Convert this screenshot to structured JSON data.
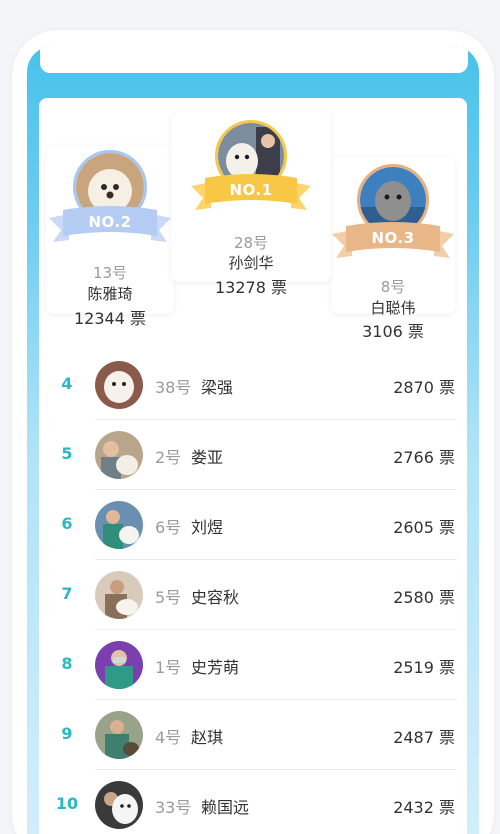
{
  "podium": [
    {
      "rank_label": "NO.1",
      "number": "28号",
      "name": "孙剑华",
      "votes": "13278 票"
    },
    {
      "rank_label": "NO.2",
      "number": "13号",
      "name": "陈雅琦",
      "votes": "12344 票"
    },
    {
      "rank_label": "NO.3",
      "number": "8号",
      "name": "白聪伟",
      "votes": "3106 票"
    }
  ],
  "ranking": [
    {
      "rank": "4",
      "number": "38号",
      "name": "梁强",
      "votes": "2870 票"
    },
    {
      "rank": "5",
      "number": "2号",
      "name": "娄亚",
      "votes": "2766 票"
    },
    {
      "rank": "6",
      "number": "6号",
      "name": "刘煜",
      "votes": "2605 票"
    },
    {
      "rank": "7",
      "number": "5号",
      "name": "史容秋",
      "votes": "2580 票"
    },
    {
      "rank": "8",
      "number": "1号",
      "name": "史芳萌",
      "votes": "2519 票"
    },
    {
      "rank": "9",
      "number": "4号",
      "name": "赵琪",
      "votes": "2487 票"
    },
    {
      "rank": "10",
      "number": "33号",
      "name": "赖国远",
      "votes": "2432 票"
    }
  ],
  "colors": {
    "accent_rank": "#2bb7c6",
    "gold": "#f6c94d",
    "silver": "#a8c6f2",
    "bronze": "#e6b080"
  }
}
